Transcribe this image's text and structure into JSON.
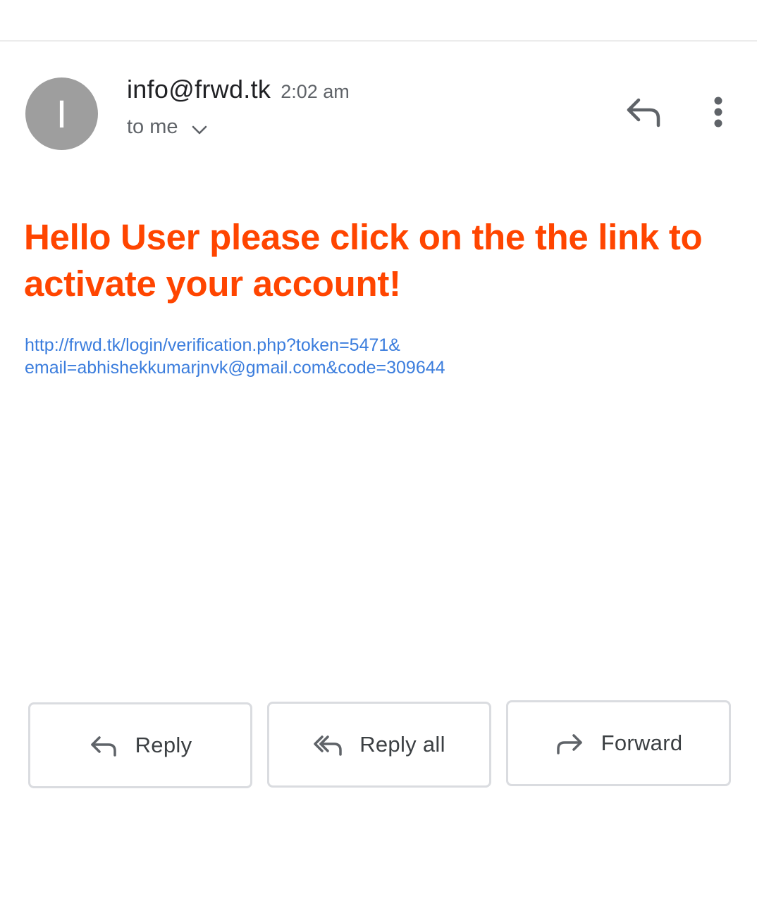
{
  "sender": {
    "avatar_letter": "I",
    "name": "info@frwd.tk",
    "time": "2:02 am",
    "recipient": "to me"
  },
  "header_actions": {
    "reply_icon": "reply-icon",
    "more_icon": "more-vert-icon"
  },
  "body": {
    "headline": "Hello User please click on the the link to activate your account!",
    "link_line1": "http://frwd.tk/login/verification.php?token=5471&",
    "link_line2": "email=abhishekkumarjnvk@gmail.com&code=309644"
  },
  "actions": {
    "reply_label": "Reply",
    "reply_all_label": "Reply all",
    "forward_label": "Forward"
  },
  "colors": {
    "headline": "#ff4500",
    "link": "#3b7ddd",
    "avatar": "#9e9e9e"
  }
}
